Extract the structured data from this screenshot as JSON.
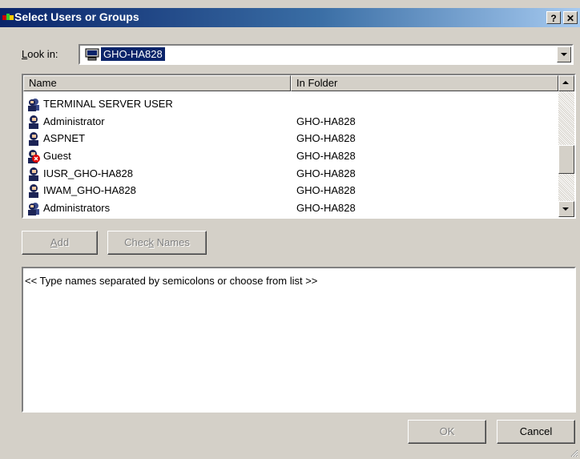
{
  "window": {
    "title": "Select Users or Groups",
    "help_label": "?",
    "close_label": "✕"
  },
  "lookin": {
    "label_accel": "L",
    "label_rest": "ook in:",
    "value": "GHO-HA828"
  },
  "list": {
    "columns": [
      "Name",
      "In Folder"
    ],
    "rows": [
      {
        "name": "TERMINAL SERVER USER",
        "folder": "",
        "icon": "group-icon"
      },
      {
        "name": "Administrator",
        "folder": "GHO-HA828",
        "icon": "user-icon"
      },
      {
        "name": "ASPNET",
        "folder": "GHO-HA828",
        "icon": "user-icon"
      },
      {
        "name": "Guest",
        "folder": "GHO-HA828",
        "icon": "disabled-user-icon"
      },
      {
        "name": "IUSR_GHO-HA828",
        "folder": "GHO-HA828",
        "icon": "user-icon"
      },
      {
        "name": "IWAM_GHO-HA828",
        "folder": "GHO-HA828",
        "icon": "user-icon"
      },
      {
        "name": "Administrators",
        "folder": "GHO-HA828",
        "icon": "group-icon"
      }
    ]
  },
  "buttons": {
    "add_accel": "A",
    "add_rest": "dd",
    "check_pre": "Chec",
    "check_accel": "k",
    "check_rest": " Names",
    "ok": "OK",
    "cancel": "Cancel"
  },
  "names_box": {
    "placeholder": "<< Type names separated by semicolons or choose from list >>"
  },
  "colors": {
    "title_start": "#0a246a",
    "title_end": "#a6caf0",
    "face": "#d4d0c8",
    "selection": "#0a246a"
  }
}
